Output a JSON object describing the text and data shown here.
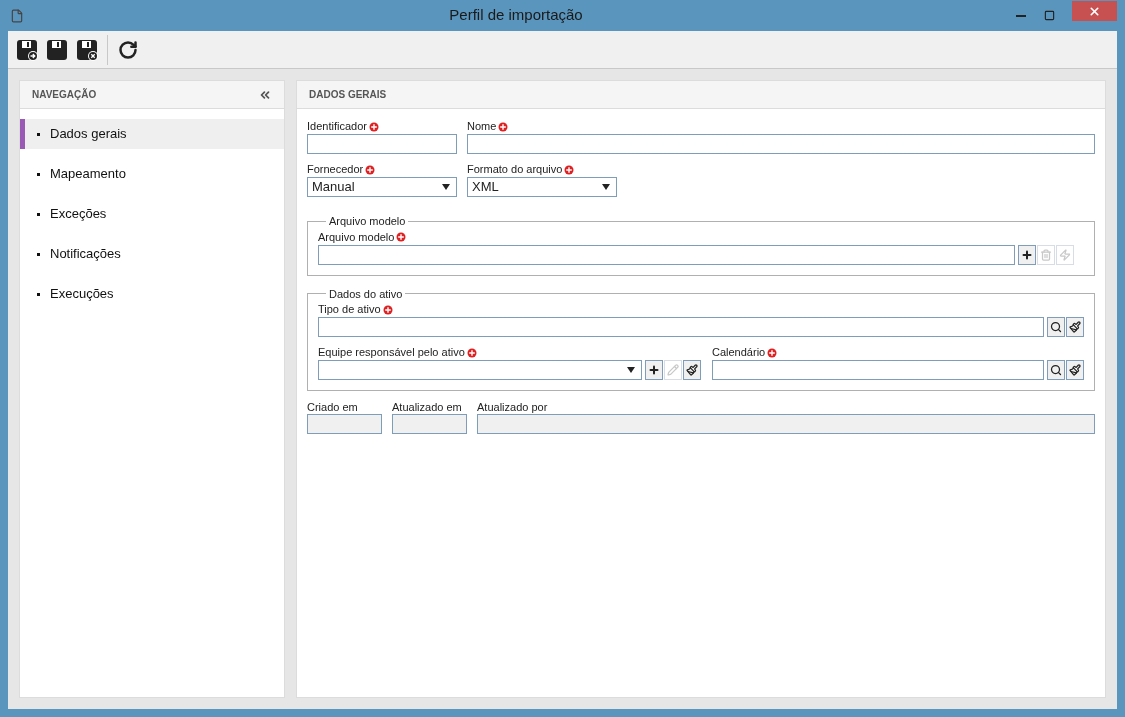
{
  "window": {
    "title": "Perfil de importação"
  },
  "navigation": {
    "title": "NAVEGAÇÃO",
    "items": [
      {
        "label": "Dados gerais",
        "selected": true
      },
      {
        "label": "Mapeamento",
        "selected": false
      },
      {
        "label": "Exceções",
        "selected": false
      },
      {
        "label": "Notificações",
        "selected": false
      },
      {
        "label": "Execuções",
        "selected": false
      }
    ]
  },
  "form": {
    "title": "DADOS GERAIS",
    "identificador": {
      "label": "Identificador",
      "required": true
    },
    "nome": {
      "label": "Nome",
      "required": true
    },
    "fornecedor": {
      "label": "Fornecedor",
      "required": true,
      "value": "Manual"
    },
    "formato_do_arquivo": {
      "label": "Formato do arquivo",
      "required": true,
      "value": "XML"
    },
    "arquivo_modelo_group": {
      "legend": "Arquivo modelo",
      "field": {
        "label": "Arquivo modelo",
        "required": true,
        "buttons": [
          {
            "kind": "add",
            "disabled": false
          },
          {
            "kind": "delete",
            "disabled": true
          },
          {
            "kind": "run",
            "disabled": true
          }
        ]
      }
    },
    "dados_do_ativo_group": {
      "legend": "Dados do ativo",
      "tipo_de_ativo": {
        "label": "Tipo de ativo",
        "required": true,
        "buttons": [
          {
            "kind": "search",
            "disabled": false
          },
          {
            "kind": "clear",
            "disabled": false
          }
        ]
      },
      "equipe": {
        "label": "Equipe responsável pelo ativo",
        "required": true,
        "buttons": [
          {
            "kind": "add",
            "disabled": false
          },
          {
            "kind": "edit",
            "disabled": true
          },
          {
            "kind": "clear",
            "disabled": false
          }
        ]
      },
      "calendario": {
        "label": "Calendário",
        "required": true,
        "buttons": [
          {
            "kind": "search",
            "disabled": false
          },
          {
            "kind": "clear",
            "disabled": false
          }
        ]
      }
    },
    "audit": [
      {
        "label": "Criado em",
        "disabled": true
      },
      {
        "label": "Atualizado em",
        "disabled": true
      },
      {
        "label": "Atualizado por",
        "disabled": true
      }
    ]
  }
}
